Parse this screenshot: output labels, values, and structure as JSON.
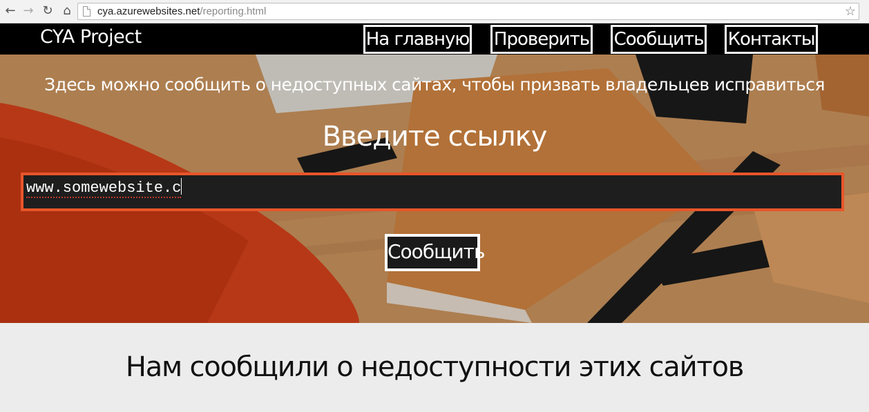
{
  "browser": {
    "back_icon": "back-arrow-icon",
    "forward_icon": "forward-arrow-icon",
    "reload_icon": "reload-icon",
    "home_icon": "home-icon",
    "url_host": "cya.azurewebsites.net",
    "url_path": "/reporting.html",
    "bookmark_icon": "star-icon"
  },
  "header": {
    "brand": "CYA Project",
    "menu": [
      {
        "label": "На главную"
      },
      {
        "label": "Проверить"
      },
      {
        "label": "Сообщить"
      },
      {
        "label": "Контакты"
      }
    ]
  },
  "hero": {
    "subtitle": "Здесь можно сообщить о недоступных сайтах, чтобы призвать владельцев исправиться",
    "title": "Введите ссылку",
    "input_value": "www.somewebsite.c",
    "submit_label": "Сообщить",
    "accent_color": "#e8552a"
  },
  "lower": {
    "title": "Нам сообщили о недоступности этих сайтов"
  }
}
